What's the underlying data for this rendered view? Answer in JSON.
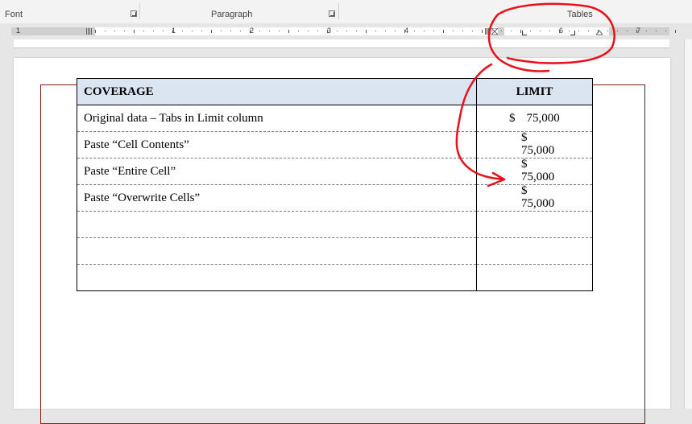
{
  "ribbon": {
    "groups": [
      {
        "label": "Font"
      },
      {
        "label": "Paragraph"
      },
      {
        "label": "Tables"
      }
    ]
  },
  "ruler": {
    "numbers": [
      "1",
      "1",
      "2",
      "3",
      "4",
      "6",
      "7"
    ]
  },
  "table": {
    "headers": {
      "coverage": "COVERAGE",
      "limit": "LIMIT"
    },
    "rows": [
      {
        "coverage": "Original data – Tabs in Limit column",
        "dollar": "$",
        "amount": "75,000",
        "layout": "inline"
      },
      {
        "coverage": "Paste “Cell Contents”",
        "dollar": "$",
        "amount": "75,000",
        "layout": "wrapped"
      },
      {
        "coverage": "Paste “Entire Cell”",
        "dollar": "$",
        "amount": "75,000",
        "layout": "wrapped"
      },
      {
        "coverage": "Paste “Overwrite Cells”",
        "dollar": "$",
        "amount": "75,000",
        "layout": "wrapped"
      },
      {
        "coverage": "",
        "dollar": "",
        "amount": "",
        "layout": "empty"
      },
      {
        "coverage": "",
        "dollar": "",
        "amount": "",
        "layout": "empty"
      },
      {
        "coverage": "",
        "dollar": "",
        "amount": "",
        "layout": "empty"
      }
    ]
  },
  "annotation": {
    "color": "#e8101a"
  },
  "colors": {
    "header_fill": "#dbe5f1",
    "page_border": "#8b1a1a"
  }
}
